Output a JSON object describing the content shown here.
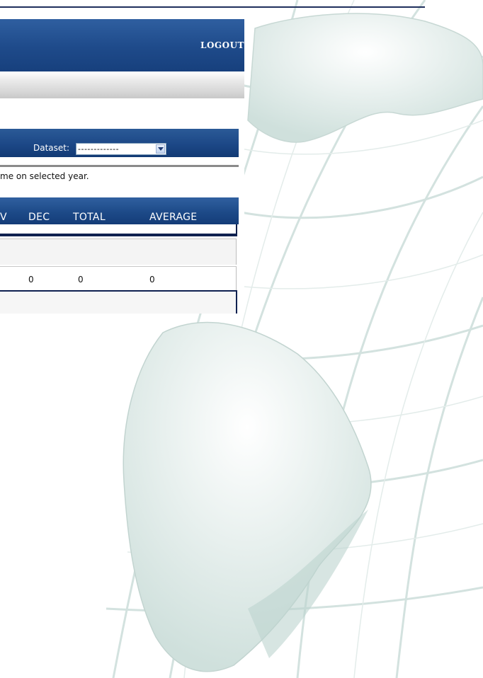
{
  "header": {
    "logout_label": "LOGOUT"
  },
  "filter": {
    "dataset_label": "Dataset:",
    "dataset_value": "-------------"
  },
  "info": {
    "text": "me on selected year."
  },
  "table": {
    "columns": [
      "V",
      "DEC",
      "TOTAL",
      "AVERAGE"
    ],
    "rows": [
      {
        "dec": "0",
        "total": "0",
        "average": "0"
      }
    ]
  }
}
